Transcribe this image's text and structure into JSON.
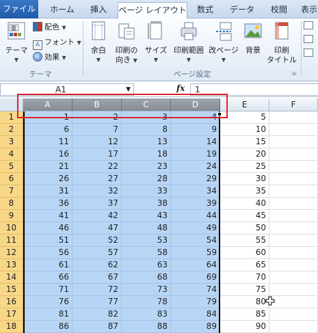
{
  "ribbon": {
    "tabs": [
      "ファイル",
      "ホーム",
      "挿入",
      "ページ レイアウト",
      "数式",
      "データ",
      "校閲",
      "表示"
    ],
    "theme_group": {
      "label": "テーマ",
      "theme_button": "テーマ",
      "colors": "配色",
      "fonts": "フォント",
      "effects": "効果"
    },
    "page_setup_group": {
      "label": "ページ設定",
      "margins": "余白",
      "orientation_line1": "印刷の",
      "orientation_line2": "向き",
      "size": "サイズ",
      "print_area": "印刷範囲",
      "breaks": "改ページ",
      "background": "背景",
      "print_titles_line1": "印刷",
      "print_titles_line2": "タイトル"
    },
    "partial_right": "表"
  },
  "formula_bar": {
    "name_box": "A1",
    "fx": "fx",
    "value": "1"
  },
  "sheet": {
    "columns": [
      "A",
      "B",
      "C",
      "D",
      "E",
      "F"
    ],
    "rows": [
      {
        "n": "1",
        "cells": [
          "1",
          "2",
          "3",
          "4",
          "5"
        ]
      },
      {
        "n": "2",
        "cells": [
          "6",
          "7",
          "8",
          "9",
          "10"
        ]
      },
      {
        "n": "3",
        "cells": [
          "11",
          "12",
          "13",
          "14",
          "15"
        ]
      },
      {
        "n": "4",
        "cells": [
          "16",
          "17",
          "18",
          "19",
          "20"
        ]
      },
      {
        "n": "5",
        "cells": [
          "21",
          "22",
          "23",
          "24",
          "25"
        ]
      },
      {
        "n": "6",
        "cells": [
          "26",
          "27",
          "28",
          "29",
          "30"
        ]
      },
      {
        "n": "7",
        "cells": [
          "31",
          "32",
          "33",
          "34",
          "35"
        ]
      },
      {
        "n": "8",
        "cells": [
          "36",
          "37",
          "38",
          "39",
          "40"
        ]
      },
      {
        "n": "9",
        "cells": [
          "41",
          "42",
          "43",
          "44",
          "45"
        ]
      },
      {
        "n": "10",
        "cells": [
          "46",
          "47",
          "48",
          "49",
          "50"
        ]
      },
      {
        "n": "11",
        "cells": [
          "51",
          "52",
          "53",
          "54",
          "55"
        ]
      },
      {
        "n": "12",
        "cells": [
          "56",
          "57",
          "58",
          "59",
          "60"
        ]
      },
      {
        "n": "13",
        "cells": [
          "61",
          "62",
          "63",
          "64",
          "65"
        ]
      },
      {
        "n": "14",
        "cells": [
          "66",
          "67",
          "68",
          "69",
          "70"
        ]
      },
      {
        "n": "15",
        "cells": [
          "71",
          "72",
          "73",
          "74",
          "75"
        ]
      },
      {
        "n": "16",
        "cells": [
          "76",
          "77",
          "78",
          "79",
          "80"
        ]
      },
      {
        "n": "17",
        "cells": [
          "81",
          "82",
          "83",
          "84",
          "85"
        ]
      },
      {
        "n": "18",
        "cells": [
          "86",
          "87",
          "88",
          "89",
          "90"
        ]
      }
    ]
  },
  "colors": {
    "selection": "#b8d5f6",
    "row_header": "#f9d788",
    "highlight_box": "#e0202a"
  }
}
